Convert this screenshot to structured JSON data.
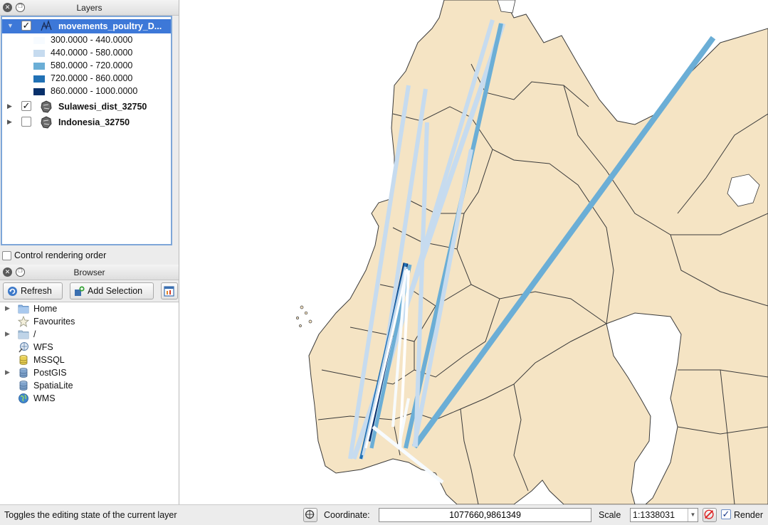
{
  "layers_panel": {
    "title": "Layers",
    "layers": [
      {
        "name": "movements_poultry_D...",
        "checked": true,
        "expanded": true,
        "selected": true,
        "icon": "line-layer-icon"
      },
      {
        "name": "Sulawesi_dist_32750",
        "checked": true,
        "expanded": false,
        "selected": false,
        "icon": "polygon-layer-icon"
      },
      {
        "name": "Indonesia_32750",
        "checked": false,
        "expanded": false,
        "selected": false,
        "icon": "polygon-layer-icon"
      }
    ],
    "legend": [
      {
        "label": "300.0000 - 440.0000",
        "color": "#f7fbff"
      },
      {
        "label": "440.0000 - 580.0000",
        "color": "#c6dbef"
      },
      {
        "label": "580.0000 - 720.0000",
        "color": "#6baed6"
      },
      {
        "label": "720.0000 - 860.0000",
        "color": "#2171b5"
      },
      {
        "label": "860.0000 - 1000.0000",
        "color": "#08306b"
      }
    ],
    "control_rendering_order": "Control rendering order"
  },
  "browser_panel": {
    "title": "Browser",
    "toolbar": {
      "refresh": "Refresh",
      "add_selection": "Add Selection"
    },
    "items": [
      {
        "label": "Home",
        "icon": "folder-icon",
        "expandable": true
      },
      {
        "label": "Favourites",
        "icon": "star-icon",
        "expandable": false
      },
      {
        "label": "/",
        "icon": "folder-icon",
        "expandable": true
      },
      {
        "label": "WFS",
        "icon": "wfs-icon",
        "expandable": false
      },
      {
        "label": "MSSQL",
        "icon": "database-icon",
        "expandable": false
      },
      {
        "label": "PostGIS",
        "icon": "database-icon",
        "expandable": true
      },
      {
        "label": "SpatiaLite",
        "icon": "database-icon",
        "expandable": false
      },
      {
        "label": "WMS",
        "icon": "globe-icon",
        "expandable": false
      }
    ]
  },
  "map": {
    "land_color": "#f5e4c4",
    "sea_color": "#ffffff",
    "boundary_color": "#3a3a3a"
  },
  "status_bar": {
    "message": "Toggles the editing state of the current layer",
    "coordinate_label": "Coordinate:",
    "coordinate_value": "1077660,9861349",
    "scale_label": "Scale",
    "scale_value": "1:1338031",
    "render_label": "Render",
    "render_checked": true
  }
}
